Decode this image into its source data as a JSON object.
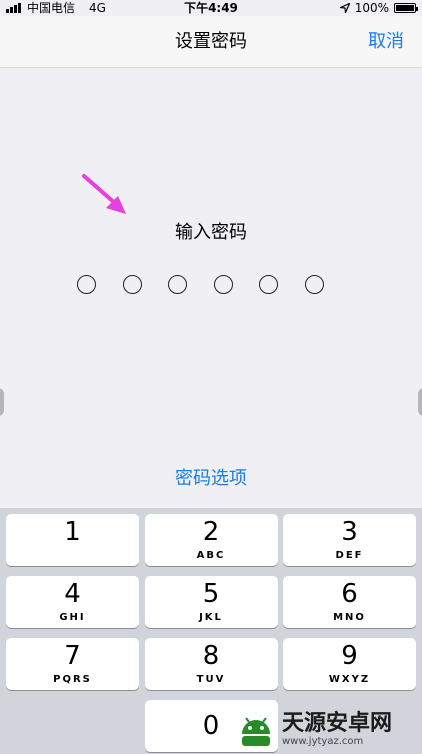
{
  "status_bar": {
    "carrier": "中国电信",
    "network": "4G",
    "time": "下午4:49",
    "battery": "100%"
  },
  "nav": {
    "title": "设置密码",
    "cancel": "取消"
  },
  "prompt": "输入密码",
  "passcode": {
    "length": 6,
    "entered": 0
  },
  "options_link": "密码选项",
  "keypad": {
    "keys": [
      {
        "num": "1",
        "letters": ""
      },
      {
        "num": "2",
        "letters": "ABC"
      },
      {
        "num": "3",
        "letters": "DEF"
      },
      {
        "num": "4",
        "letters": "GHI"
      },
      {
        "num": "5",
        "letters": "JKL"
      },
      {
        "num": "6",
        "letters": "MNO"
      },
      {
        "num": "7",
        "letters": "PQRS"
      },
      {
        "num": "8",
        "letters": "TUV"
      },
      {
        "num": "9",
        "letters": "WXYZ"
      },
      {
        "num": "0",
        "letters": ""
      }
    ]
  },
  "watermark": {
    "name": "天源安卓网",
    "url": "www.jytyaz.com"
  },
  "colors": {
    "accent": "#1a7ce5",
    "arrow": "#e83fe0",
    "background": "#efeff4",
    "keypad_bg": "#d1d4db"
  },
  "icons": [
    "signal-bars-icon",
    "location-arrow-icon",
    "battery-icon",
    "pointer-arrow-icon",
    "android-logo-icon"
  ]
}
